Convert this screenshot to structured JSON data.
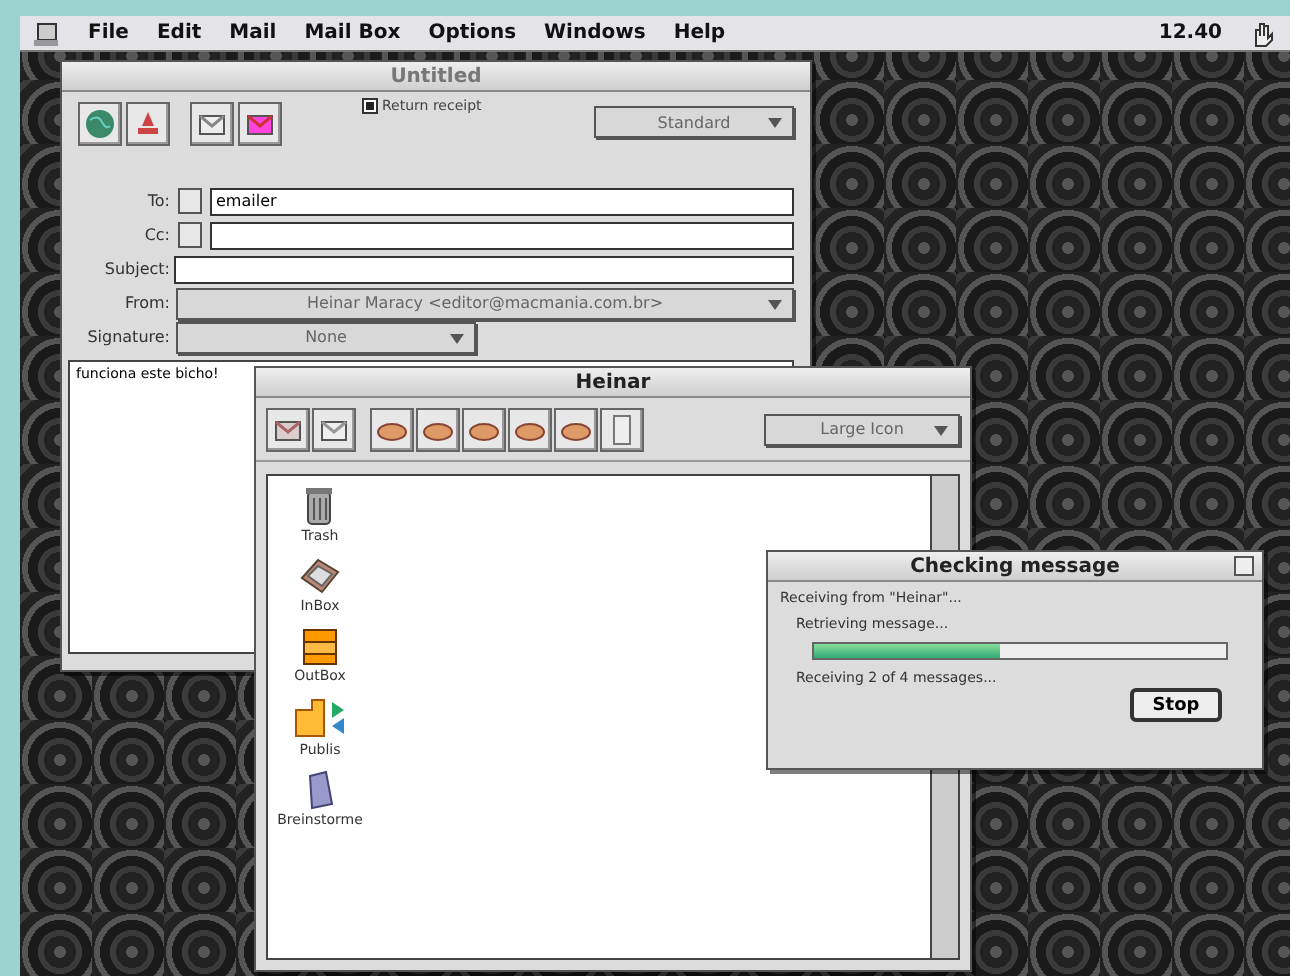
{
  "menu_bar": {
    "items": [
      "File",
      "Edit",
      "Mail",
      "Mail Box",
      "Options",
      "Windows",
      "Help"
    ],
    "clock": "12.40"
  },
  "compose_window": {
    "title": "Untitled",
    "return_receipt": {
      "label": "Return receipt",
      "checked": true
    },
    "priority": "Standard",
    "to": {
      "label": "To:",
      "value": "emailer"
    },
    "cc": {
      "label": "Cc:"
    },
    "subject": {
      "label": "Subject:"
    },
    "from": {
      "label": "From:",
      "value": "Heinar Maracy <editor@macmania.com.br>"
    },
    "signature": {
      "label": "Signature:",
      "value": "None"
    },
    "body": "funciona este bicho!"
  },
  "mailbox_window": {
    "title": "Heinar",
    "view": "Large Icon",
    "items": [
      {
        "label": "Trash",
        "kind": "trash"
      },
      {
        "label": "InBox",
        "kind": "inbox"
      },
      {
        "label": "OutBox",
        "kind": "outbox"
      },
      {
        "label": "Publis",
        "kind": "shared"
      },
      {
        "label": "Breinstorme",
        "kind": "tray"
      }
    ]
  },
  "progress_dialog": {
    "title": "Checking message",
    "status": "Receiving from \"Heinar\"...",
    "task": "Retrieving message...",
    "level": 0.45,
    "detail": "Receiving 2 of 4 messages...",
    "button": "Stop"
  }
}
